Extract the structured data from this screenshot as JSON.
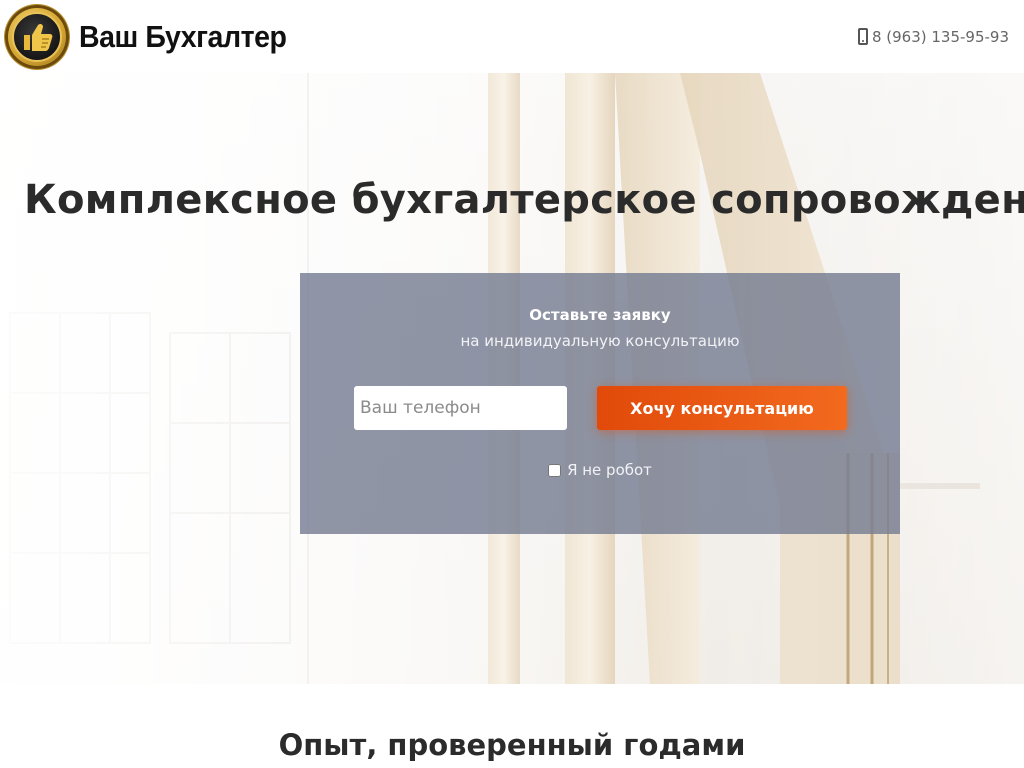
{
  "header": {
    "brand_name": "Ваш Бухгалтер",
    "phone": "8 (963) 135-95-93"
  },
  "hero": {
    "title": "Комплексное бухгалтерское сопровождение б"
  },
  "form": {
    "title": "Оставьте заявку",
    "subtitle": "на индивидуальную консультацию",
    "phone_placeholder": "Ваш телефон",
    "submit_label": "Хочу консультацию",
    "robot_label": "Я не робот"
  },
  "section": {
    "title": "Опыт, проверенный годами"
  },
  "colors": {
    "accent": "#e95b12",
    "panel": "#767e93",
    "text": "#2b2b2b"
  },
  "icons": [
    "thumbs-up-logo-icon",
    "mobile-phone-icon"
  ]
}
